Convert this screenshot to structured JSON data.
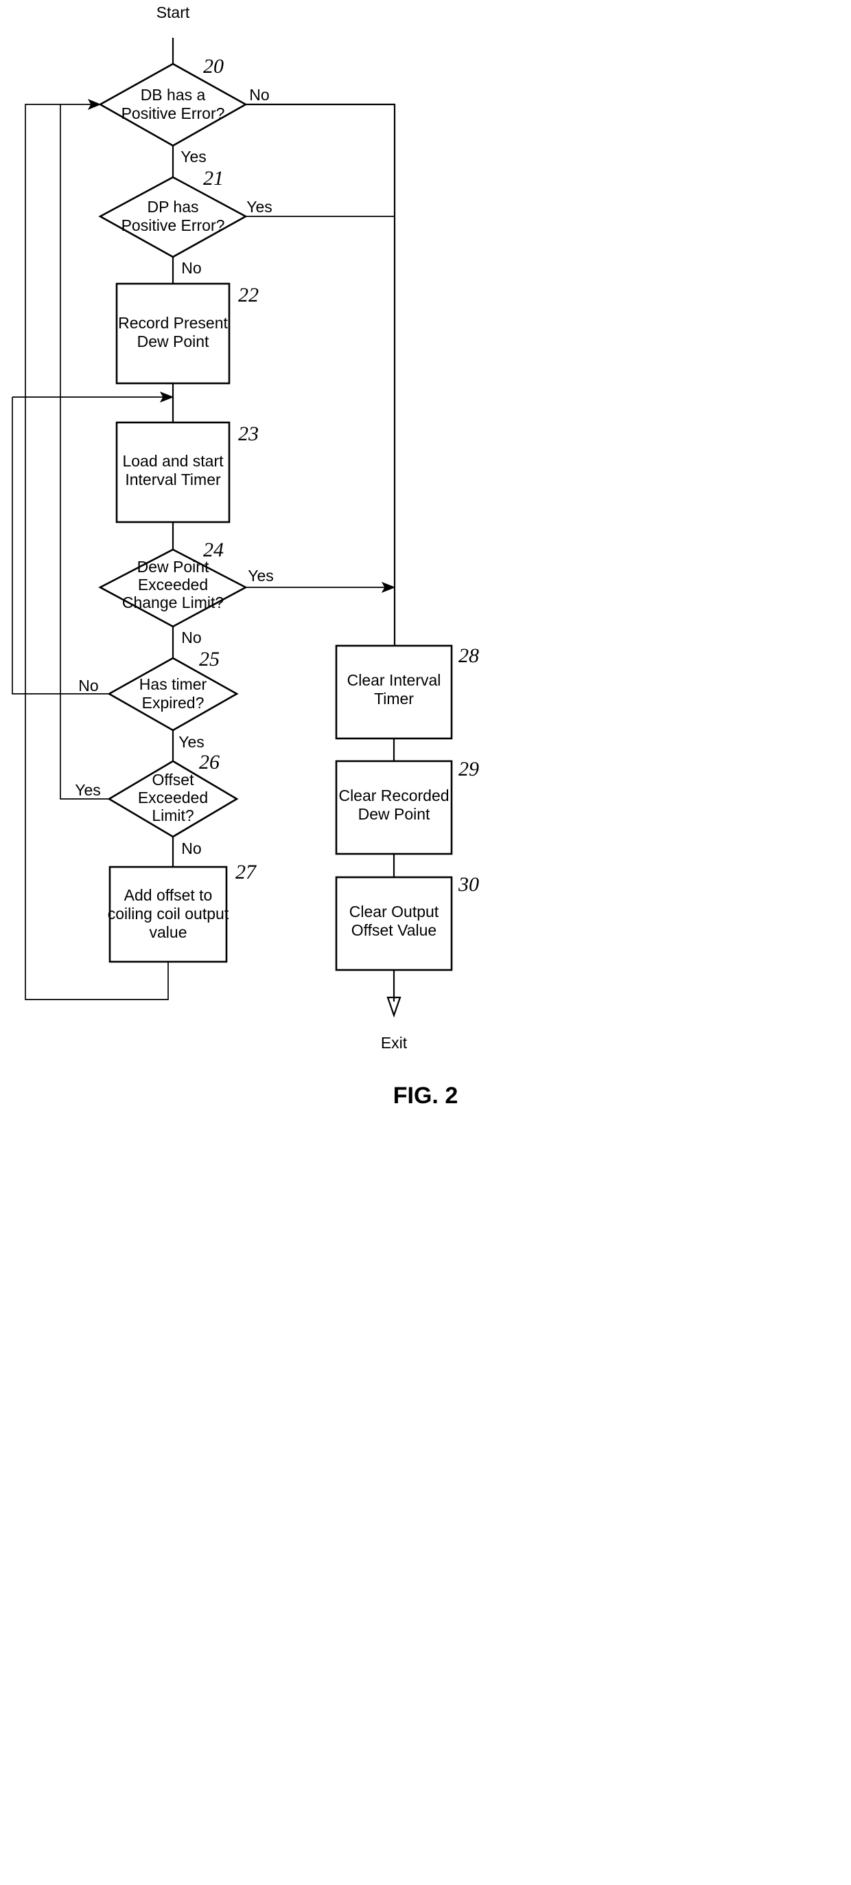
{
  "figure": {
    "caption": "FIG. 2",
    "start_label": "Start",
    "exit_label": "Exit"
  },
  "nodes": [
    {
      "id": "n20",
      "ref": "20",
      "type": "decision",
      "lines": [
        "DB has a",
        "Positive Error?"
      ]
    },
    {
      "id": "n21",
      "ref": "21",
      "type": "decision",
      "lines": [
        "DP has",
        "Positive Error?"
      ]
    },
    {
      "id": "n22",
      "ref": "22",
      "type": "process",
      "lines": [
        "Record Present",
        "Dew Point"
      ]
    },
    {
      "id": "n23",
      "ref": "23",
      "type": "process",
      "lines": [
        "Load and start",
        "Interval Timer"
      ]
    },
    {
      "id": "n24",
      "ref": "24",
      "type": "decision",
      "lines": [
        "Dew Point",
        "Exceeded",
        "Change Limit?"
      ]
    },
    {
      "id": "n25",
      "ref": "25",
      "type": "decision",
      "lines": [
        "Has timer",
        "Expired?"
      ]
    },
    {
      "id": "n26",
      "ref": "26",
      "type": "decision",
      "lines": [
        "Offset",
        "Exceeded",
        "Limit?"
      ]
    },
    {
      "id": "n27",
      "ref": "27",
      "type": "process",
      "lines": [
        "Add offset to",
        "coiling coil output",
        "value"
      ]
    },
    {
      "id": "n28",
      "ref": "28",
      "type": "process",
      "lines": [
        "Clear Interval",
        "Timer"
      ]
    },
    {
      "id": "n29",
      "ref": "29",
      "type": "process",
      "lines": [
        "Clear Recorded",
        "Dew Point"
      ]
    },
    {
      "id": "n30",
      "ref": "30",
      "type": "process",
      "lines": [
        "Clear Output",
        "Offset Value"
      ]
    }
  ],
  "edge_labels": {
    "e20_no": "No",
    "e20_yes": "Yes",
    "e21_yes": "Yes",
    "e21_no": "No",
    "e24_yes": "Yes",
    "e24_no": "No",
    "e25_no": "No",
    "e25_yes": "Yes",
    "e26_yes": "Yes",
    "e26_no": "No"
  },
  "colors": {
    "stroke": "#000000",
    "background": "#ffffff"
  }
}
